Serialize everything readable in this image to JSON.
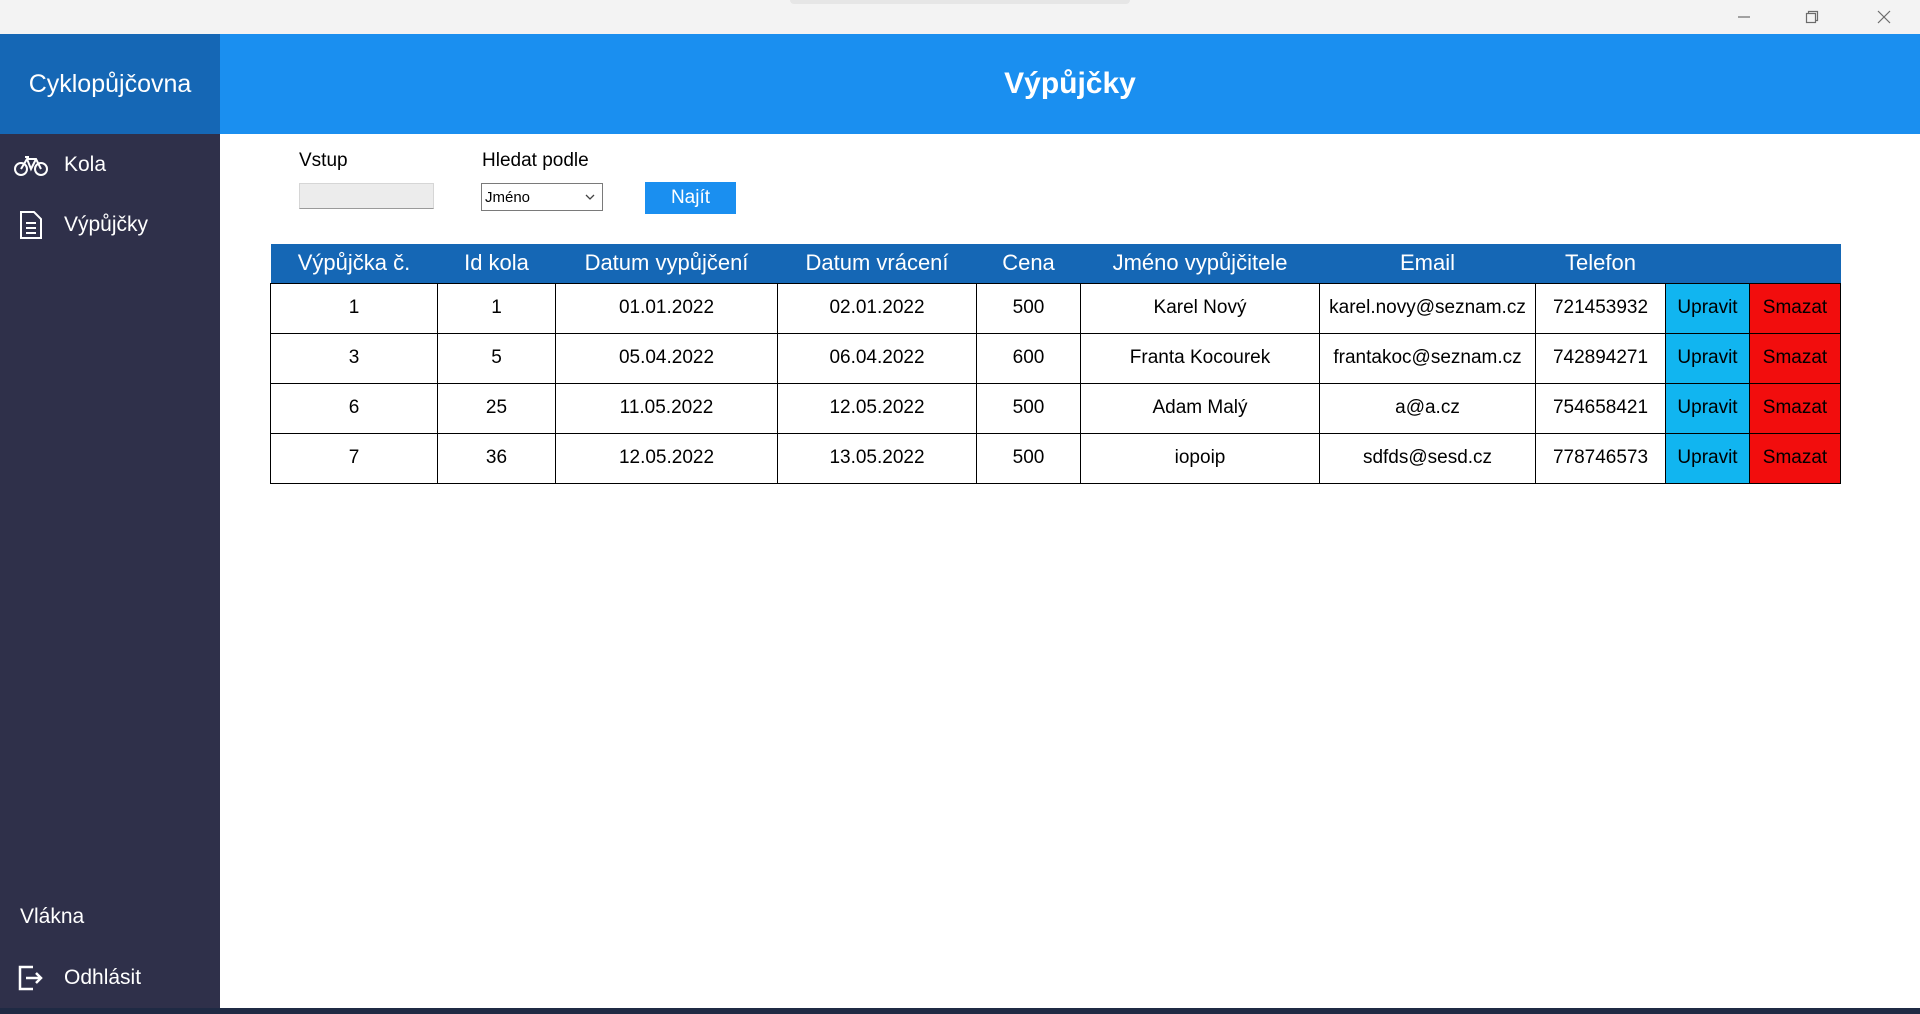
{
  "window": {
    "minimize_icon": "minimize-icon",
    "restore_icon": "restore-icon",
    "close_icon": "close-icon"
  },
  "sidebar": {
    "brand": "Cyklopůjčovna",
    "items": [
      {
        "label": "Kola",
        "icon": "bicycle-icon"
      },
      {
        "label": "Výpůjčky",
        "icon": "document-icon"
      }
    ],
    "threads_label": "Vlákna",
    "logout": {
      "label": "Odhlásit",
      "icon": "logout-icon"
    }
  },
  "header": {
    "title": "Výpůjčky"
  },
  "filter": {
    "input_label": "Vstup",
    "input_value": "",
    "search_by_label": "Hledat podle",
    "search_by_value": "Jméno",
    "find_label": "Najít"
  },
  "table": {
    "columns": [
      "Výpůjčka č.",
      "Id kola",
      "Datum vypůjčení",
      "Datum vrácení",
      "Cena",
      "Jméno vypůjčitele",
      "Email",
      "Telefon",
      "",
      ""
    ],
    "rows": [
      [
        "1",
        "1",
        "01.01.2022",
        "02.01.2022",
        "500",
        "Karel Nový",
        "karel.novy@seznam.cz",
        "721453932",
        "Upravit",
        "Smazat"
      ],
      [
        "3",
        "5",
        "05.04.2022",
        "06.04.2022",
        "600",
        "Franta Kocourek",
        "frantakoc@seznam.cz",
        "742894271",
        "Upravit",
        "Smazat"
      ],
      [
        "6",
        "25",
        "11.05.2022",
        "12.05.2022",
        "500",
        "Adam Malý",
        "a@a.cz",
        "754658421",
        "Upravit",
        "Smazat"
      ],
      [
        "7",
        "36",
        "12.05.2022",
        "13.05.2022",
        "500",
        "iopoip",
        "sdfds@sesd.cz",
        "778746573",
        "Upravit",
        "Smazat"
      ]
    ]
  },
  "colors": {
    "sidebar": "#2f304a",
    "brand": "#1567b5",
    "header": "#1a8ff0",
    "edit": "#11b5f0",
    "delete": "#f20d0d"
  }
}
